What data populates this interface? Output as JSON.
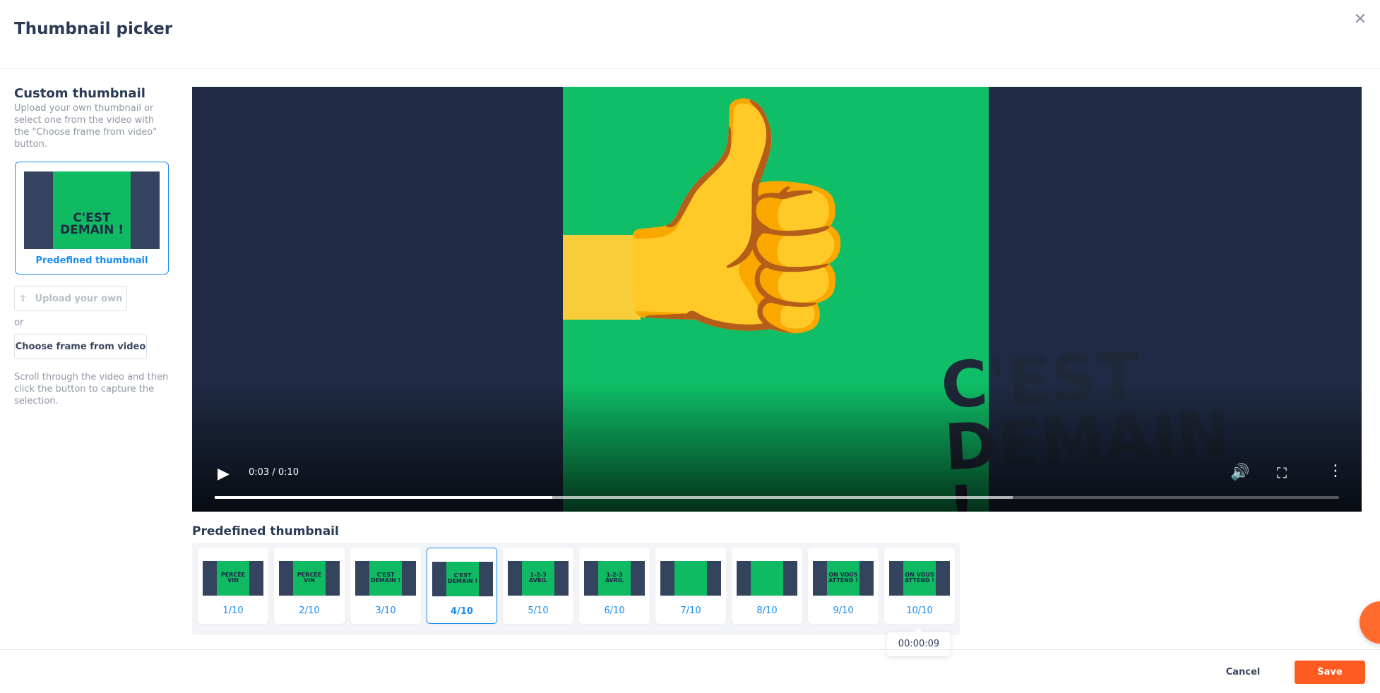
{
  "header": {
    "title": "Thumbnail picker",
    "close_icon": "close-icon"
  },
  "sidebar": {
    "heading": "Custom thumbnail",
    "description": "Upload your own thumbnail or select one from the video with the \"Choose frame from video\" button.",
    "card_label": "Predefined thumbnail",
    "card_image_text": "C'EST DEMAIN !",
    "upload_label": "Upload your own",
    "or": "or",
    "choose_label": "Choose frame from video",
    "scroll_hint": "Scroll through the video and then click the button to capture the selection."
  },
  "video": {
    "frame_text": "C'EST DEMAIN !",
    "time": "0:03 / 0:10",
    "played_fraction": 0.3,
    "buffered_fraction": 0.71
  },
  "predefined": {
    "heading": "Predefined thumbnail",
    "selected_index": 3,
    "items": [
      {
        "label": "1/10",
        "img": "PERCÉE VIN"
      },
      {
        "label": "2/10",
        "img": "PERCÉE VIN"
      },
      {
        "label": "3/10",
        "img": "C'EST DEMAIN !"
      },
      {
        "label": "4/10",
        "img": "C'EST DEMAIN !"
      },
      {
        "label": "5/10",
        "img": "1-2-3 AVRIL"
      },
      {
        "label": "6/10",
        "img": "1-2-3 AVRIL"
      },
      {
        "label": "7/10",
        "img": ""
      },
      {
        "label": "8/10",
        "img": ""
      },
      {
        "label": "9/10",
        "img": "ON VOUS ATTEND !"
      },
      {
        "label": "10/10",
        "img": "ON VOUS ATTEND !"
      }
    ],
    "tooltip": "00:00:09"
  },
  "footer": {
    "cancel": "Cancel",
    "save": "Save"
  },
  "colors": {
    "accent": "#1a8cf0",
    "save": "#ff5a1f",
    "video_green": "#0fbe66",
    "video_bg": "#1f2b44"
  }
}
